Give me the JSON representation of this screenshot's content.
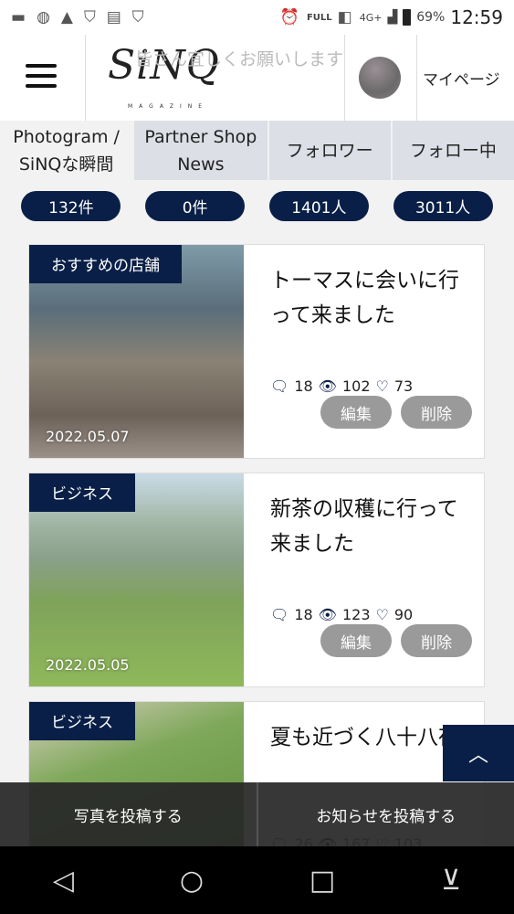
{
  "status_bar": {
    "battery": "69%",
    "time": "12:59",
    "network": "4G+",
    "storage_badge": "FULL"
  },
  "header": {
    "logo": "SiNQ",
    "logo_sub": "MAGAZINE",
    "marquee": "皆さん宜しくお願いします",
    "mypage": "マイページ"
  },
  "tabs": [
    {
      "label": "Photogram / SiNQな瞬間",
      "count": "132件"
    },
    {
      "label": "Partner Shop News",
      "count": "0件"
    },
    {
      "label": "フォロワー",
      "count": "1401人"
    },
    {
      "label": "フォロー中",
      "count": "3011人"
    }
  ],
  "posts": [
    {
      "category": "おすすめの店舗",
      "date": "2022.05.07",
      "title": "トーマスに会いに行って来ました",
      "comments": "18",
      "views": "102",
      "likes": "73"
    },
    {
      "category": "ビジネス",
      "date": "2022.05.05",
      "title": "新茶の収穫に行って来ました",
      "comments": "18",
      "views": "123",
      "likes": "90"
    },
    {
      "category": "ビジネス",
      "date": "",
      "title": "夏も近づく八十八夜",
      "comments": "26",
      "views": "167",
      "likes": "103"
    }
  ],
  "actions": {
    "edit": "編集",
    "delete": "削除"
  },
  "bottom_bar": {
    "post_photo": "写真を投稿する",
    "post_news": "お知らせを投稿する"
  },
  "colors": {
    "navy": "#0a1f47",
    "tab_bg": "#dcdfe5",
    "button_gray": "#9a9a9a"
  }
}
